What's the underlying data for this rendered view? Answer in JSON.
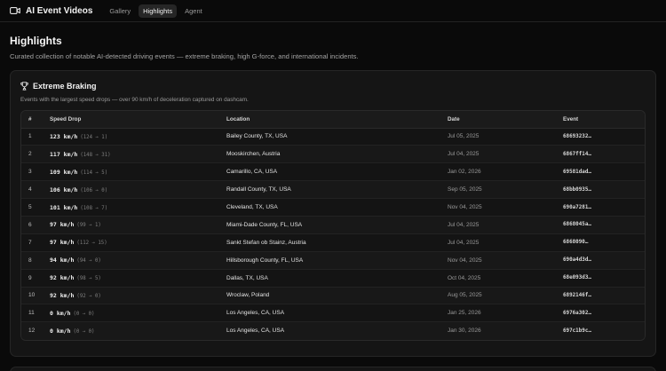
{
  "app": {
    "title": "AI Event Videos"
  },
  "nav": [
    {
      "label": "Gallery",
      "active": false
    },
    {
      "label": "Highlights",
      "active": true
    },
    {
      "label": "Agent",
      "active": false
    }
  ],
  "page": {
    "title": "Highlights",
    "subtitle": "Curated collection of notable AI-detected driving events — extreme braking, high G-force, and international incidents."
  },
  "section": {
    "title": "Extreme Braking",
    "icon": "trophy-icon",
    "description": "Events with the largest speed drops — over 90 km/h of deceleration captured on dashcam."
  },
  "table": {
    "headers": {
      "index": "#",
      "speed": "Speed Drop",
      "location": "Location",
      "date": "Date",
      "event": "Event"
    },
    "rows": [
      {
        "index": "1",
        "speed": "123 km/h",
        "detail": "(124 → 1)",
        "location": "Bailey County, TX, USA",
        "date": "Jul 05, 2025",
        "event": "68693232…"
      },
      {
        "index": "2",
        "speed": "117 km/h",
        "detail": "(148 → 31)",
        "location": "Mooskirchen, Austria",
        "date": "Jul 04, 2025",
        "event": "6867ff14…"
      },
      {
        "index": "3",
        "speed": "109 km/h",
        "detail": "(114 → 5)",
        "location": "Camarillo, CA, USA",
        "date": "Jan 02, 2026",
        "event": "69581dad…"
      },
      {
        "index": "4",
        "speed": "106 km/h",
        "detail": "(106 → 0)",
        "location": "Randall County, TX, USA",
        "date": "Sep 05, 2025",
        "event": "68bb0935…"
      },
      {
        "index": "5",
        "speed": "101 km/h",
        "detail": "(108 → 7)",
        "location": "Cleveland, TX, USA",
        "date": "Nov 04, 2025",
        "event": "690a7281…"
      },
      {
        "index": "6",
        "speed": "97 km/h",
        "detail": "(99 → 1)",
        "location": "Miami-Dade County, FL, USA",
        "date": "Jul 04, 2025",
        "event": "6868045a…"
      },
      {
        "index": "7",
        "speed": "97 km/h",
        "detail": "(112 → 15)",
        "location": "Sankt Stefan ob Stainz, Austria",
        "date": "Jul 04, 2025",
        "event": "6868090…"
      },
      {
        "index": "8",
        "speed": "94 km/h",
        "detail": "(94 → 0)",
        "location": "Hillsborough County, FL, USA",
        "date": "Nov 04, 2025",
        "event": "690a4d3d…"
      },
      {
        "index": "9",
        "speed": "92 km/h",
        "detail": "(98 → 5)",
        "location": "Dallas, TX, USA",
        "date": "Oct 04, 2025",
        "event": "68e093d3…"
      },
      {
        "index": "10",
        "speed": "92 km/h",
        "detail": "(92 → 0)",
        "location": "Wroclaw, Poland",
        "date": "Aug 05, 2025",
        "event": "6892146f…"
      },
      {
        "index": "11",
        "speed": "0 km/h",
        "detail": "(0 → 0)",
        "location": "Los Angeles, CA, USA",
        "date": "Jan 25, 2026",
        "event": "6976a302…"
      },
      {
        "index": "12",
        "speed": "0 km/h",
        "detail": "(0 → 0)",
        "location": "Los Angeles, CA, USA",
        "date": "Jan 30, 2026",
        "event": "697c1b9c…"
      }
    ]
  }
}
